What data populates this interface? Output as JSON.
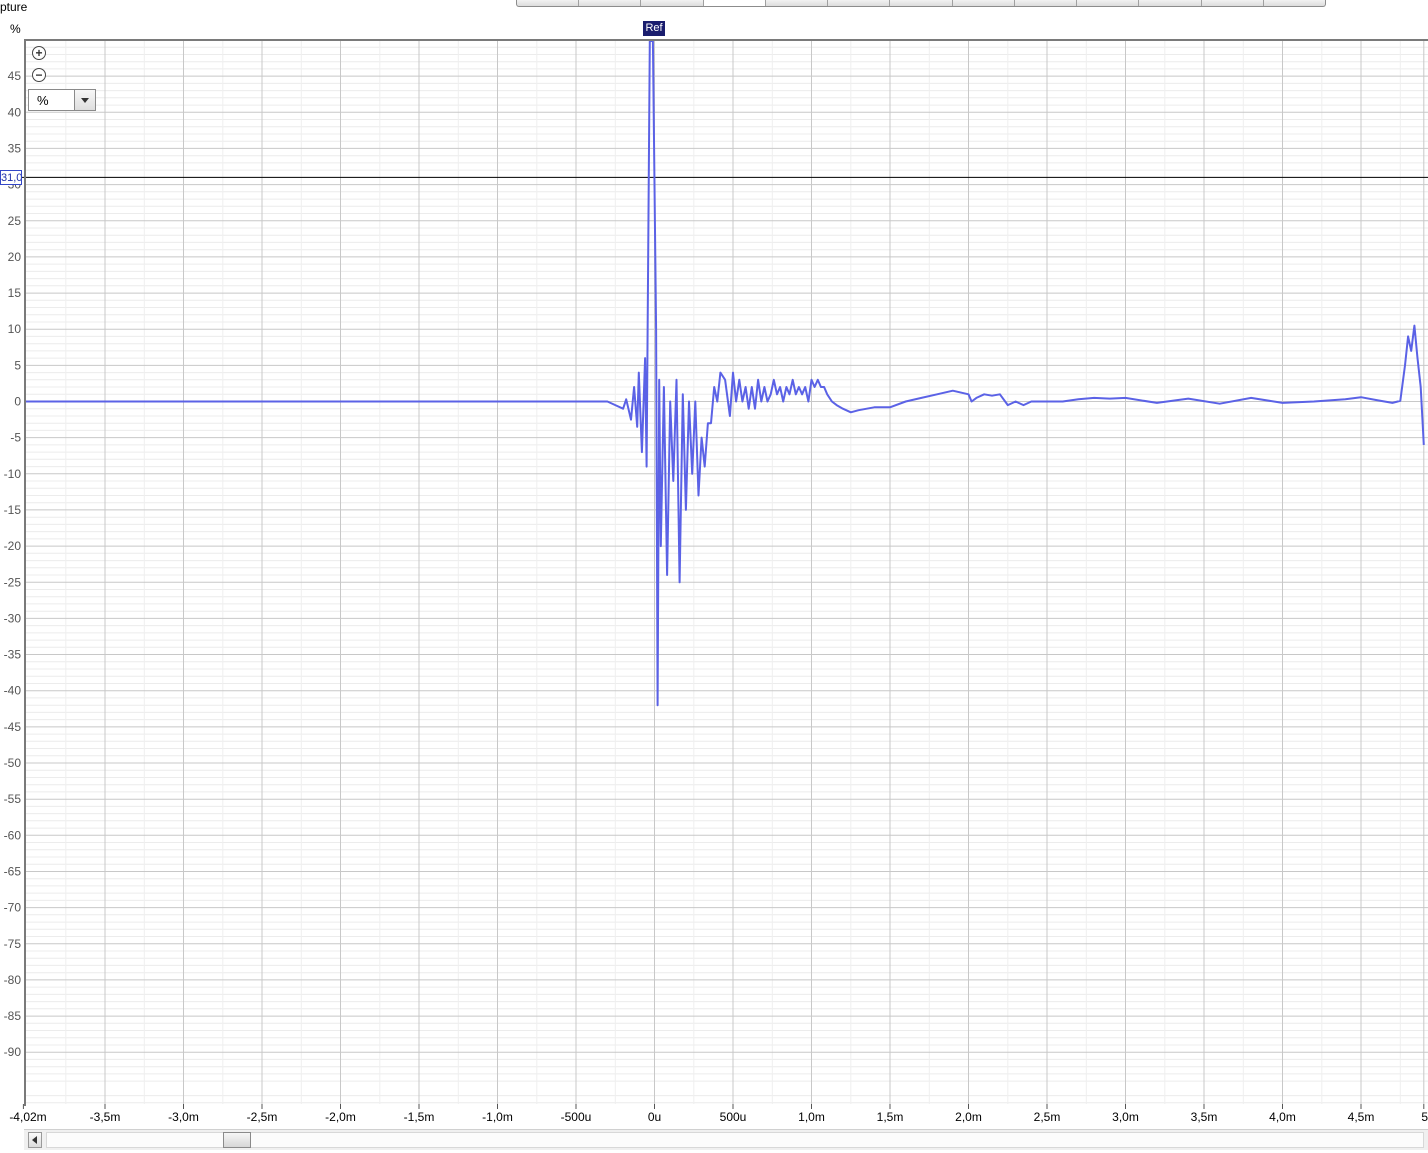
{
  "app": {
    "title": "pture"
  },
  "toolbar": {
    "tabs": [
      "",
      "",
      "",
      "",
      "",
      "",
      "",
      "",
      "",
      "",
      "",
      "",
      ""
    ],
    "active_tab": 3
  },
  "plot": {
    "unit_label": "%",
    "zoom_in_icon": "zoom-in-icon",
    "zoom_out_icon": "zoom-out-icon",
    "unit_select_value": "%",
    "cursor_value": "31,0",
    "ref_marker_label": "Ref",
    "trace_color": "#5b62e6",
    "cursor_color": "#000000"
  },
  "chart_data": {
    "type": "line",
    "x_unit": "s",
    "xlim": [
      -0.00402,
      0.0049
    ],
    "ylim": [
      -100,
      50
    ],
    "y_ticks": [
      45,
      40,
      35,
      30,
      25,
      20,
      15,
      10,
      5,
      0,
      -5,
      -10,
      -15,
      -20,
      -25,
      -30,
      -35,
      -40,
      -45,
      -50,
      -55,
      -60,
      -65,
      -70,
      -75,
      -80,
      -85,
      -90
    ],
    "y_tick_labels": [
      "45",
      "40",
      "35",
      "30",
      "25",
      "20",
      "15",
      "10",
      "5",
      "0",
      "-5",
      "-10",
      "-15",
      "-20",
      "-25",
      "-30",
      "-35",
      "-40",
      "-45",
      "-50",
      "-55",
      "-60",
      "-65",
      "-70",
      "-75",
      "-80",
      "-85",
      "-90"
    ],
    "x_ticks": [
      -0.00402,
      -0.0035,
      -0.003,
      -0.0025,
      -0.002,
      -0.0015,
      -0.001,
      -0.0005,
      0,
      0.0005,
      0.001,
      0.0015,
      0.002,
      0.0025,
      0.003,
      0.0035,
      0.004,
      0.0045,
      0.0049
    ],
    "x_tick_labels": [
      "-4,02m",
      "-3,5m",
      "-3,0m",
      "-2,5m",
      "-2,0m",
      "-1,5m",
      "-1,0m",
      "-500u",
      "0u",
      "500u",
      "1,0m",
      "1,5m",
      "2,0m",
      "2,5m",
      "3,0m",
      "3,5m",
      "4,0m",
      "4,5m",
      "5"
    ],
    "grid": true,
    "cursor_y": 31.0,
    "series": [
      {
        "x": [
          -0.00402,
          -0.0035,
          -0.003,
          -0.0025,
          -0.002,
          -0.0015,
          -0.001,
          -0.0005,
          -0.0003,
          -0.00025,
          -0.0002,
          -0.00018,
          -0.00015,
          -0.00013,
          -0.00011,
          -0.0001,
          -8e-05,
          -6e-05,
          -5e-05,
          -3e-05,
          -2e-05,
          -1e-05,
          0,
          1e-05,
          2e-05,
          3e-05,
          4e-05,
          6e-05,
          8e-05,
          0.0001,
          0.00012,
          0.00014,
          0.00016,
          0.00018,
          0.0002,
          0.00022,
          0.00024,
          0.00026,
          0.00028,
          0.0003,
          0.00032,
          0.00034,
          0.00036,
          0.00038,
          0.0004,
          0.00042,
          0.00045,
          0.00048,
          0.0005,
          0.00052,
          0.00054,
          0.00056,
          0.00058,
          0.0006,
          0.00062,
          0.00064,
          0.00066,
          0.00068,
          0.0007,
          0.00072,
          0.00074,
          0.00076,
          0.00078,
          0.0008,
          0.00082,
          0.00084,
          0.00086,
          0.00088,
          0.0009,
          0.00092,
          0.00094,
          0.00096,
          0.00098,
          0.001,
          0.00102,
          0.00104,
          0.00106,
          0.00108,
          0.0011,
          0.00113,
          0.00116,
          0.0012,
          0.00125,
          0.0013,
          0.0014,
          0.0015,
          0.0016,
          0.0017,
          0.0018,
          0.0019,
          0.002,
          0.00202,
          0.00205,
          0.0021,
          0.00215,
          0.0022,
          0.00225,
          0.0023,
          0.00235,
          0.0024,
          0.0025,
          0.0026,
          0.0027,
          0.0028,
          0.0029,
          0.003,
          0.0032,
          0.0034,
          0.0036,
          0.0038,
          0.004,
          0.0042,
          0.0044,
          0.0045,
          0.0046,
          0.0047,
          0.00475,
          0.00478,
          0.0048,
          0.00482,
          0.00484,
          0.00486,
          0.00488,
          0.0049
        ],
        "y": [
          0,
          0,
          0,
          0,
          0,
          0,
          0,
          0,
          0,
          -0.5,
          -1,
          0.3,
          -2.5,
          2,
          -3.5,
          4,
          -7,
          6,
          -9,
          60,
          60,
          50,
          30,
          10,
          -42,
          3,
          -20,
          2,
          -24,
          0,
          -11,
          3,
          -25,
          1,
          -15,
          0,
          -10,
          0,
          -13,
          -5,
          -9,
          -3,
          -3,
          2,
          0,
          4,
          3,
          -2,
          4,
          0,
          3,
          0,
          2,
          -1,
          2,
          -1,
          3,
          0,
          2,
          0,
          1,
          3,
          1,
          2,
          0,
          2,
          1,
          3,
          1,
          2,
          1,
          2,
          0,
          3,
          2,
          3,
          2,
          2,
          1,
          0,
          -0.5,
          -1,
          -1.5,
          -1.2,
          -0.8,
          -0.8,
          0,
          0.5,
          1,
          1.5,
          1,
          0,
          0.5,
          1,
          0.8,
          1,
          -0.5,
          0,
          -0.5,
          0,
          0,
          0,
          0.3,
          0.5,
          0.4,
          0.5,
          -0.2,
          0.4,
          -0.3,
          0.5,
          -0.2,
          0,
          0.3,
          0.6,
          0.2,
          -0.2,
          0.1,
          5,
          9,
          7,
          10.5,
          6,
          2,
          -6
        ]
      }
    ]
  }
}
